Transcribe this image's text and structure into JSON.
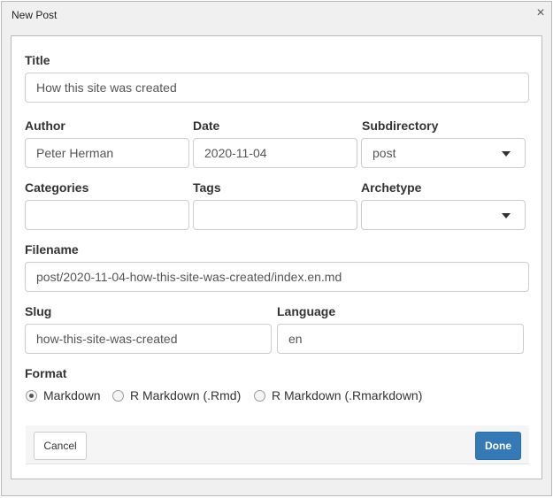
{
  "window": {
    "title": "New Post",
    "close_glyph": "×"
  },
  "fields": {
    "title": {
      "label": "Title",
      "value": "How this site was created"
    },
    "author": {
      "label": "Author",
      "value": "Peter Herman"
    },
    "date": {
      "label": "Date",
      "value": "2020-11-04"
    },
    "subdirectory": {
      "label": "Subdirectory",
      "value": "post"
    },
    "categories": {
      "label": "Categories",
      "value": ""
    },
    "tags": {
      "label": "Tags",
      "value": ""
    },
    "archetype": {
      "label": "Archetype",
      "value": ""
    },
    "filename": {
      "label": "Filename",
      "value": "post/2020-11-04-how-this-site-was-created/index.en.md"
    },
    "slug": {
      "label": "Slug",
      "value": "how-this-site-was-created"
    },
    "language": {
      "label": "Language",
      "value": "en"
    }
  },
  "format": {
    "label": "Format",
    "options": [
      {
        "label": "Markdown",
        "selected": true
      },
      {
        "label": "R Markdown (.Rmd)",
        "selected": false
      },
      {
        "label": "R Markdown (.Rmarkdown)",
        "selected": false
      }
    ]
  },
  "buttons": {
    "cancel": "Cancel",
    "done": "Done"
  },
  "colors": {
    "primary": "#337ab7",
    "border": "#cccccc",
    "window_bg": "#f0f0f0"
  }
}
